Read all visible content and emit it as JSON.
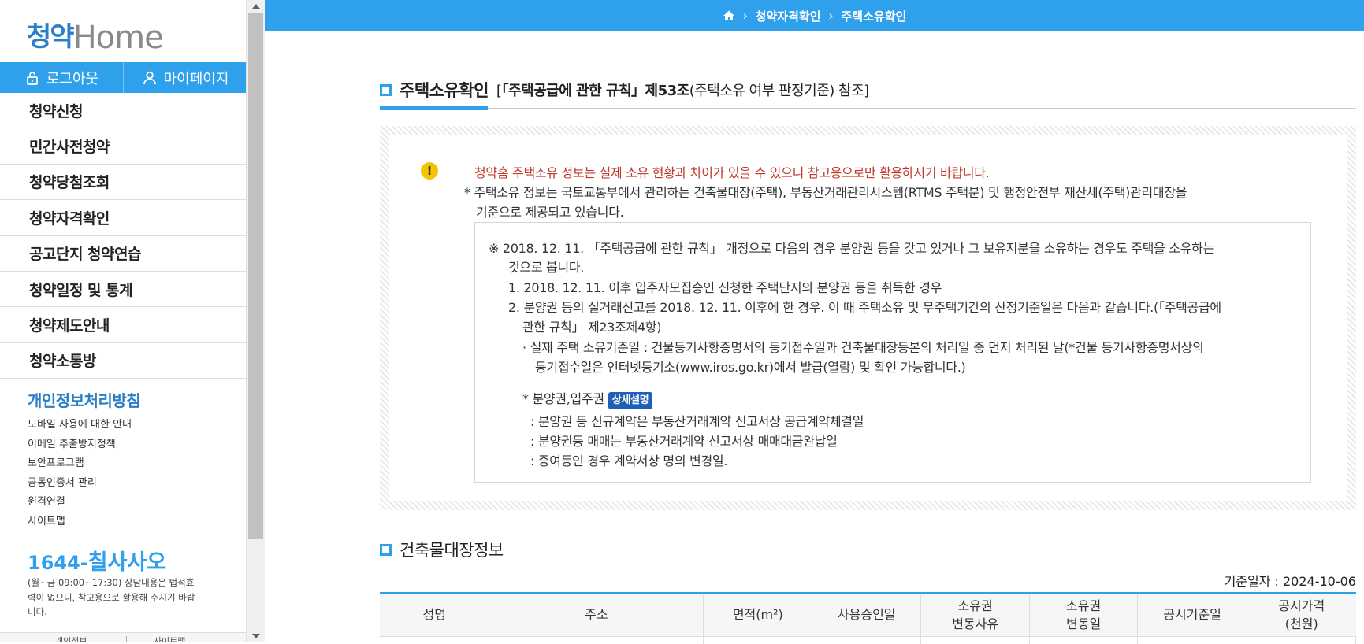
{
  "sidebar": {
    "logo": {
      "korean": "청약",
      "english": "Home"
    },
    "logout_label": "로그아웃",
    "mypage_label": "마이페이지",
    "menu": [
      "청약신청",
      "민간사전청약",
      "청약당첨조회",
      "청약자격확인",
      "공고단지 청약연습",
      "청약일정 및 통계",
      "청약제도안내",
      "청약소통방"
    ],
    "privacy_title": "개인정보처리방침",
    "sublinks": [
      "모바일 사용에 대한 안내",
      "이메일 추출방지정책",
      "보안프로그램",
      "공동인증서 관리",
      "원격연결",
      "사이트맵"
    ],
    "phone_prefix": "1644-",
    "phone_text": "칠사사오",
    "phone_note": "(월~금 09:00~17:30) 상담내용은 법적효력이 없으니, 참고용으로 활용해 주시기 바랍니다.",
    "bottom_left": "개인정보",
    "bottom_right": "사이트맵"
  },
  "breadcrumb": [
    "청약자격확인",
    "주택소유확인"
  ],
  "section1": {
    "title": "주택소유확인",
    "subtitle_open": "[",
    "subtitle_bold": "「주택공급에 관한 규칙」제53조",
    "subtitle_rest": "(주택소유 여부 판정기준) 참조",
    "subtitle_close": "]"
  },
  "notice": {
    "warning": "청약홈 주택소유 정보는 실제 소유 현황과 차이가 있을 수 있으니 참고용으로만 활용하시기 바랍니다.",
    "note_line1": "* 주택소유 정보는 국토교통부에서 관리하는 건축물대장(주택), 부동산거래관리시스템(RTMS 주택분) 및 행정안전부 재산세(주택)관리대장을",
    "note_line2": "기준으로 제공되고 있습니다.",
    "rule_l1": "※  2018. 12. 11. 「주택공급에 관한 규칙」 개정으로 다음의 경우 분양권 등을 갖고 있거나 그 보유지분을 소유하는 경우도 주택을 소유하는",
    "rule_l2": "것으로 봅니다.",
    "rule_l3": "1. 2018. 12. 11. 이후 입주자모집승인 신청한 주택단지의 분양권 등을 취득한 경우",
    "rule_l4": "2. 분양권 등의 실거래신고를 2018. 12. 11. 이후에 한 경우. 이 때 주택소유 및 무주택기간의 산정기준일은 다음과 같습니다.(「주택공급에",
    "rule_l5": "관한 규칙」 제23조제4항)",
    "rule_l6": "· 실제 주택 소유기준일 : 건물등기사항증명서의 등기접수일과 건축물대장등본의 처리일 중 먼저 처리된 날(*건물 등기사항증명서상의",
    "rule_l7": "등기접수일은 인터넷등기소(www.iros.go.kr)에서 발급(열람) 및 확인 가능합니다.)",
    "rule_l8": "* 분양권,입주권",
    "detail_badge": "상세설명",
    "rule_l9": ": 분양권 등 신규계약은 부동산거래계약 신고서상 공급계약체결일",
    "rule_l10": ": 분양권등 매매는 부동산거래계약 신고서상 매매대금완납일",
    "rule_l11": ": 증여등인 경우 계약서상 명의 변경일."
  },
  "section2": {
    "title": "건축물대장정보",
    "base_date": "기준일자 : 2024-10-06",
    "headers": [
      "성명",
      "주소",
      "면적(m²)",
      "사용승인일",
      "소유권\n변동사유",
      "소유권\n변동일",
      "공시기준일",
      "공시가격\n(천원)"
    ]
  }
}
